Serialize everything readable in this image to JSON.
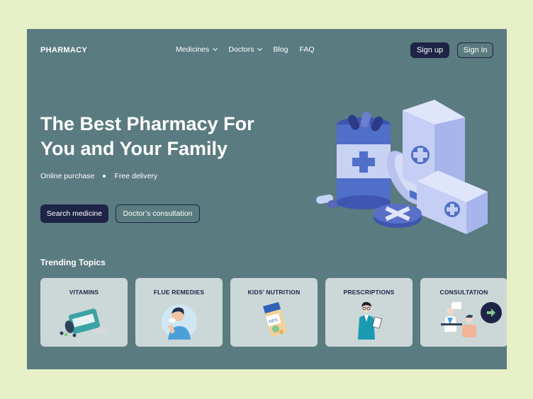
{
  "brand": {
    "logo": "PHARMACY"
  },
  "nav": {
    "items": [
      {
        "label": "Medicines",
        "dropdown": true
      },
      {
        "label": "Doctors",
        "dropdown": true
      },
      {
        "label": "Blog",
        "dropdown": false
      },
      {
        "label": "FAQ",
        "dropdown": false
      }
    ],
    "signup_label": "Sign up",
    "signin_label": "Sign in"
  },
  "hero": {
    "title_line1": "The Best Pharmacy For",
    "title_line2": "You and Your Family",
    "feature1": "Online purchase",
    "feature2": "Free delivery",
    "search_button": "Search medicine",
    "consult_button": "Doctor’s consultation"
  },
  "trending": {
    "title": "Trending Topics",
    "cards": [
      {
        "label": "VITAMINS",
        "icon": "vitamins-bottle-icon"
      },
      {
        "label": "FLUE REMEDIES",
        "icon": "sick-person-icon"
      },
      {
        "label": "KIDS’ NUTRITION",
        "icon": "baby-food-box-icon"
      },
      {
        "label": "PRESCRIPTIONS",
        "icon": "pharmacist-icon"
      },
      {
        "label": "CONSULTATION",
        "icon": "doctor-consultation-icon"
      }
    ]
  },
  "colors": {
    "page_bg": "#e7efc7",
    "frame_bg": "#5a7b80",
    "dark_navy": "#1e2446",
    "card_bg": "#ccd7d8",
    "accent_green": "#7fc98f",
    "illustration_blue": "#8a9ae0"
  }
}
